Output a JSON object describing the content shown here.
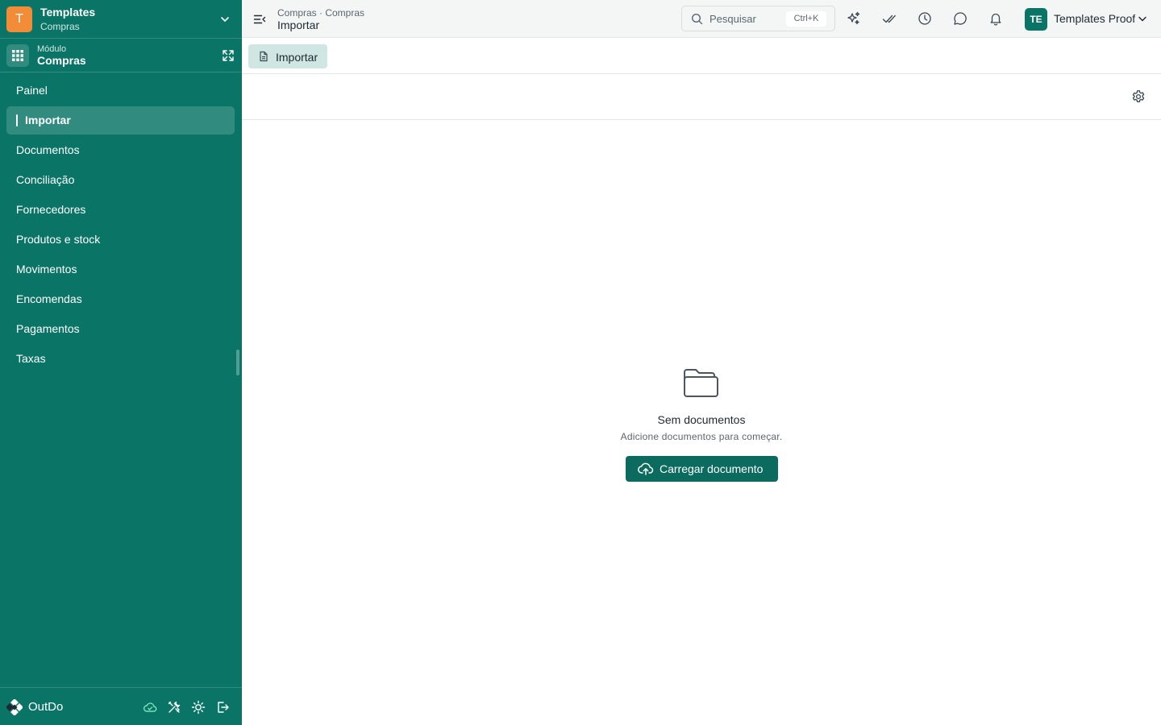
{
  "org": {
    "avatar_letter": "T",
    "name": "Templates",
    "subtitle": "Compras",
    "avatar_color": "#f28c38"
  },
  "module": {
    "label": "Módulo",
    "name": "Compras"
  },
  "sidebar": {
    "items": [
      {
        "label": "Painel"
      },
      {
        "label": "Importar",
        "active": true
      },
      {
        "label": "Documentos"
      },
      {
        "label": "Conciliação"
      },
      {
        "label": "Fornecedores"
      },
      {
        "label": "Produtos e stock"
      },
      {
        "label": "Movimentos"
      },
      {
        "label": "Encomendas"
      },
      {
        "label": "Pagamentos"
      },
      {
        "label": "Taxas"
      }
    ]
  },
  "footer": {
    "brand": "OutDo",
    "icons": [
      "cloud-check-icon",
      "tools-icon",
      "sun-icon",
      "logout-icon"
    ]
  },
  "topbar": {
    "breadcrumb": "Compras · Compras",
    "title": "Importar",
    "search_placeholder": "Pesquisar",
    "search_shortcut": "Ctrl+K",
    "icons": [
      "sparkles-icon",
      "double-check-icon",
      "clock-icon",
      "chat-icon",
      "bell-icon"
    ],
    "user": {
      "initials": "TE",
      "name": "Templates Proof"
    }
  },
  "tabs": [
    {
      "label": "Importar",
      "icon": "document-icon"
    }
  ],
  "empty_state": {
    "title": "Sem documentos",
    "subtitle": "Adicione documentos para começar.",
    "button": "Carregar documento"
  },
  "colors": {
    "sidebar": "#0a7566",
    "primary_button": "#0a6b5e",
    "active_tab": "#cfe6e2",
    "topbar": "#f4f6f6"
  }
}
